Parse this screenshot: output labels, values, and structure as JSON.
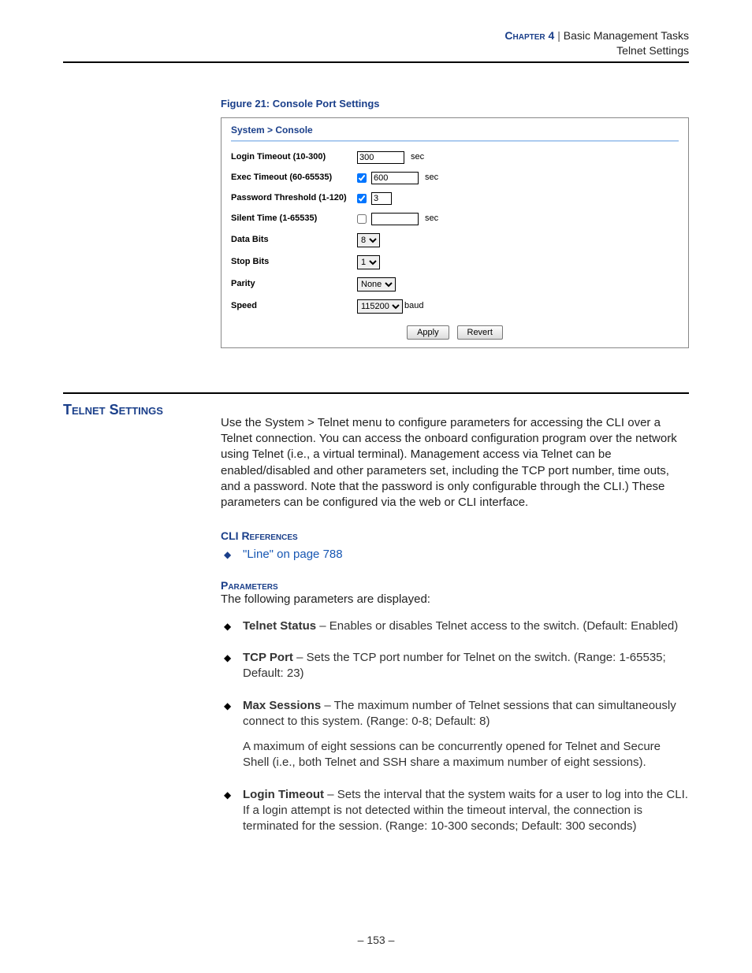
{
  "header": {
    "chapter": "Chapter 4",
    "divider": "  |  ",
    "title": "Basic Management Tasks",
    "subtitle": "Telnet Settings"
  },
  "figure": {
    "caption": "Figure 21:  Console Port Settings",
    "breadcrumb": "System > Console",
    "rows": {
      "loginTimeout": {
        "label": "Login Timeout (10-300)",
        "value": "300",
        "unit": "sec"
      },
      "execTimeout": {
        "label": "Exec Timeout (60-65535)",
        "cb": true,
        "value": "600",
        "unit": "sec"
      },
      "pwdThreshold": {
        "label": "Password Threshold (1-120)",
        "cb": true,
        "value": "3"
      },
      "silentTime": {
        "label": "Silent Time (1-65535)",
        "cb": false,
        "value": "",
        "unit": "sec"
      },
      "dataBits": {
        "label": "Data Bits",
        "value": "8"
      },
      "stopBits": {
        "label": "Stop Bits",
        "value": "1"
      },
      "parity": {
        "label": "Parity",
        "value": "None"
      },
      "speed": {
        "label": "Speed",
        "value": "115200",
        "unit": "baud"
      }
    },
    "buttons": {
      "apply": "Apply",
      "revert": "Revert"
    }
  },
  "section": {
    "title": "Telnet Settings",
    "intro": "Use the System > Telnet menu to configure parameters for accessing the CLI over a Telnet connection. You can access the onboard configuration program over the network using Telnet (i.e., a virtual terminal). Management access via Telnet can be enabled/disabled and other parameters set, including the TCP port number, time outs, and a password. Note that the password is only configurable through the CLI.) These parameters can be configured via the web or CLI interface.",
    "cliRefsHead": "CLI References",
    "cliRefLink": "\"Line\" on page 788",
    "paramsHead": "Parameters",
    "paramsIntro": "The following parameters are displayed:",
    "items": {
      "telnetStatus": {
        "name": "Telnet Status",
        "text": " – Enables or disables Telnet access to the switch. (Default: Enabled)"
      },
      "tcpPort": {
        "name": "TCP Port",
        "text": " – Sets the TCP port number for Telnet on the switch. (Range: 1-65535; Default: 23)"
      },
      "maxSessions": {
        "name": "Max Sessions",
        "text": " – The maximum number of Telnet sessions that can simultaneously connect to this system. (Range: 0-8; Default: 8)",
        "extra": "A maximum of eight sessions can be concurrently opened for Telnet and Secure Shell (i.e., both Telnet and SSH share a maximum number of eight sessions)."
      },
      "loginTimeout": {
        "name": "Login Timeout",
        "text": " – Sets the interval that the system waits for a user to log into the CLI. If a login attempt is not detected within the timeout interval, the connection is terminated for the session. (Range: 10-300 seconds; Default: 300 seconds)"
      }
    }
  },
  "pageNumber": "–  153  –"
}
